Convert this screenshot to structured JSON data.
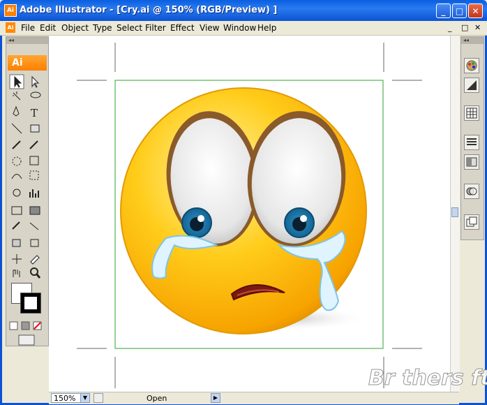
{
  "window": {
    "title": "Adobe Illustrator - [Cry.ai @ 150% (RGB/Preview) ]",
    "app_icon": "Ai",
    "min_label": "_",
    "max_label": "□",
    "close_label": "✕"
  },
  "menubar": {
    "doc_icon": "Ai",
    "items": [
      "File",
      "Edit",
      "Object",
      "Type",
      "Select",
      "Filter",
      "Effect",
      "View",
      "Window",
      "Help"
    ],
    "doc_controls": [
      "_",
      "□",
      "✕"
    ]
  },
  "toolbox": {
    "header": "◂◂",
    "logo": "Ai",
    "tools": [
      "selection",
      "direct-selection",
      "magic-wand",
      "lasso",
      "pen",
      "type",
      "line",
      "rectangle",
      "paintbrush",
      "pencil",
      "rotate",
      "scale",
      "warp",
      "free-transform",
      "symbol-sprayer",
      "column-graph",
      "mesh",
      "gradient",
      "eyedropper",
      "blend",
      "live-paint",
      "live-paint-selection",
      "slice",
      "eraser",
      "hand",
      "zoom"
    ]
  },
  "right_panel": {
    "header": "◂◂",
    "buttons": [
      "color-icon",
      "gradient-icon",
      "swatches-icon",
      "stroke-icon",
      "transparency-icon",
      "appearance-icon",
      "layers-icon"
    ]
  },
  "statusbar": {
    "zoom": "150%",
    "status": "Open"
  },
  "artwork": {
    "description_name": "crying-smiley"
  },
  "watermark": "Br thers ft",
  "colors": {
    "titlebar": "#0a5fe0",
    "accent": "#ff7f00",
    "face": "#ffc21a",
    "artboard_border": "#2fa32f"
  }
}
